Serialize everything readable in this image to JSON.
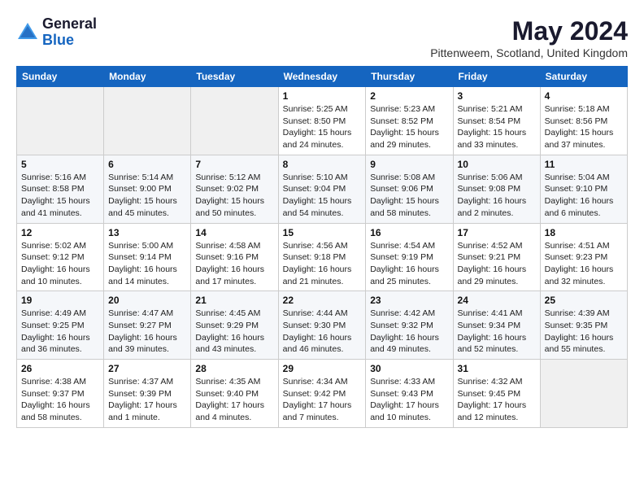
{
  "logo": {
    "general": "General",
    "blue": "Blue"
  },
  "title": "May 2024",
  "location": "Pittenweem, Scotland, United Kingdom",
  "days_of_week": [
    "Sunday",
    "Monday",
    "Tuesday",
    "Wednesday",
    "Thursday",
    "Friday",
    "Saturday"
  ],
  "weeks": [
    [
      {
        "day": "",
        "info": ""
      },
      {
        "day": "",
        "info": ""
      },
      {
        "day": "",
        "info": ""
      },
      {
        "day": "1",
        "info": "Sunrise: 5:25 AM\nSunset: 8:50 PM\nDaylight: 15 hours\nand 24 minutes."
      },
      {
        "day": "2",
        "info": "Sunrise: 5:23 AM\nSunset: 8:52 PM\nDaylight: 15 hours\nand 29 minutes."
      },
      {
        "day": "3",
        "info": "Sunrise: 5:21 AM\nSunset: 8:54 PM\nDaylight: 15 hours\nand 33 minutes."
      },
      {
        "day": "4",
        "info": "Sunrise: 5:18 AM\nSunset: 8:56 PM\nDaylight: 15 hours\nand 37 minutes."
      }
    ],
    [
      {
        "day": "5",
        "info": "Sunrise: 5:16 AM\nSunset: 8:58 PM\nDaylight: 15 hours\nand 41 minutes."
      },
      {
        "day": "6",
        "info": "Sunrise: 5:14 AM\nSunset: 9:00 PM\nDaylight: 15 hours\nand 45 minutes."
      },
      {
        "day": "7",
        "info": "Sunrise: 5:12 AM\nSunset: 9:02 PM\nDaylight: 15 hours\nand 50 minutes."
      },
      {
        "day": "8",
        "info": "Sunrise: 5:10 AM\nSunset: 9:04 PM\nDaylight: 15 hours\nand 54 minutes."
      },
      {
        "day": "9",
        "info": "Sunrise: 5:08 AM\nSunset: 9:06 PM\nDaylight: 15 hours\nand 58 minutes."
      },
      {
        "day": "10",
        "info": "Sunrise: 5:06 AM\nSunset: 9:08 PM\nDaylight: 16 hours\nand 2 minutes."
      },
      {
        "day": "11",
        "info": "Sunrise: 5:04 AM\nSunset: 9:10 PM\nDaylight: 16 hours\nand 6 minutes."
      }
    ],
    [
      {
        "day": "12",
        "info": "Sunrise: 5:02 AM\nSunset: 9:12 PM\nDaylight: 16 hours\nand 10 minutes."
      },
      {
        "day": "13",
        "info": "Sunrise: 5:00 AM\nSunset: 9:14 PM\nDaylight: 16 hours\nand 14 minutes."
      },
      {
        "day": "14",
        "info": "Sunrise: 4:58 AM\nSunset: 9:16 PM\nDaylight: 16 hours\nand 17 minutes."
      },
      {
        "day": "15",
        "info": "Sunrise: 4:56 AM\nSunset: 9:18 PM\nDaylight: 16 hours\nand 21 minutes."
      },
      {
        "day": "16",
        "info": "Sunrise: 4:54 AM\nSunset: 9:19 PM\nDaylight: 16 hours\nand 25 minutes."
      },
      {
        "day": "17",
        "info": "Sunrise: 4:52 AM\nSunset: 9:21 PM\nDaylight: 16 hours\nand 29 minutes."
      },
      {
        "day": "18",
        "info": "Sunrise: 4:51 AM\nSunset: 9:23 PM\nDaylight: 16 hours\nand 32 minutes."
      }
    ],
    [
      {
        "day": "19",
        "info": "Sunrise: 4:49 AM\nSunset: 9:25 PM\nDaylight: 16 hours\nand 36 minutes."
      },
      {
        "day": "20",
        "info": "Sunrise: 4:47 AM\nSunset: 9:27 PM\nDaylight: 16 hours\nand 39 minutes."
      },
      {
        "day": "21",
        "info": "Sunrise: 4:45 AM\nSunset: 9:29 PM\nDaylight: 16 hours\nand 43 minutes."
      },
      {
        "day": "22",
        "info": "Sunrise: 4:44 AM\nSunset: 9:30 PM\nDaylight: 16 hours\nand 46 minutes."
      },
      {
        "day": "23",
        "info": "Sunrise: 4:42 AM\nSunset: 9:32 PM\nDaylight: 16 hours\nand 49 minutes."
      },
      {
        "day": "24",
        "info": "Sunrise: 4:41 AM\nSunset: 9:34 PM\nDaylight: 16 hours\nand 52 minutes."
      },
      {
        "day": "25",
        "info": "Sunrise: 4:39 AM\nSunset: 9:35 PM\nDaylight: 16 hours\nand 55 minutes."
      }
    ],
    [
      {
        "day": "26",
        "info": "Sunrise: 4:38 AM\nSunset: 9:37 PM\nDaylight: 16 hours\nand 58 minutes."
      },
      {
        "day": "27",
        "info": "Sunrise: 4:37 AM\nSunset: 9:39 PM\nDaylight: 17 hours\nand 1 minute."
      },
      {
        "day": "28",
        "info": "Sunrise: 4:35 AM\nSunset: 9:40 PM\nDaylight: 17 hours\nand 4 minutes."
      },
      {
        "day": "29",
        "info": "Sunrise: 4:34 AM\nSunset: 9:42 PM\nDaylight: 17 hours\nand 7 minutes."
      },
      {
        "day": "30",
        "info": "Sunrise: 4:33 AM\nSunset: 9:43 PM\nDaylight: 17 hours\nand 10 minutes."
      },
      {
        "day": "31",
        "info": "Sunrise: 4:32 AM\nSunset: 9:45 PM\nDaylight: 17 hours\nand 12 minutes."
      },
      {
        "day": "",
        "info": ""
      }
    ]
  ]
}
